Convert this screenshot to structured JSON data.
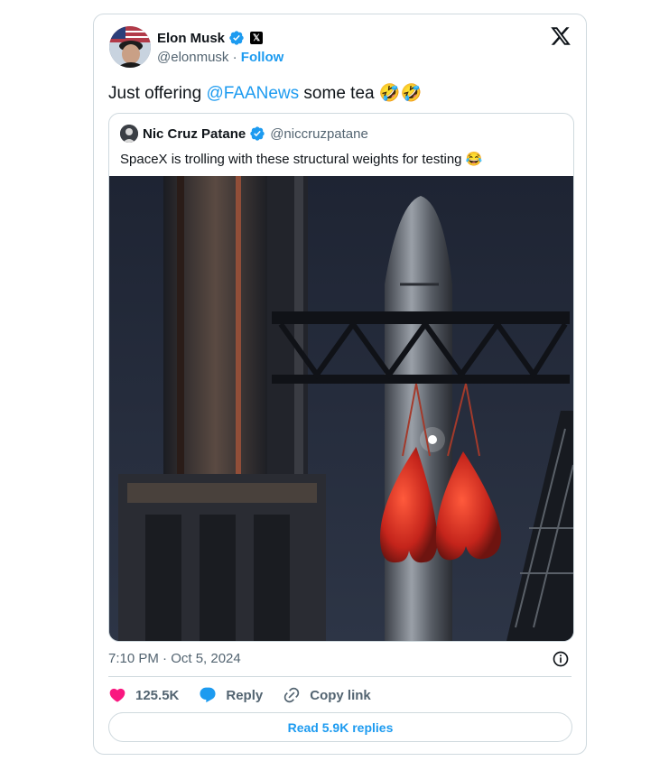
{
  "author": {
    "name": "Elon Musk",
    "handle": "@elonmusk",
    "separator": "·",
    "follow_label": "Follow"
  },
  "tweet": {
    "text_before": "Just offering ",
    "mention": "@FAANews",
    "text_after": " some tea 🤣🤣"
  },
  "quoted": {
    "name": "Nic Cruz Patane",
    "handle": "@niccruzpatane",
    "text": "SpaceX is trolling with these structural weights for testing 😂"
  },
  "meta": {
    "timestamp": "7:10 PM · Oct 5, 2024"
  },
  "actions": {
    "likes": "125.5K",
    "reply_label": "Reply",
    "copy_link_label": "Copy link"
  },
  "read_replies_label": "Read 5.9K replies",
  "colors": {
    "accent": "#1d9bf0",
    "like": "#f91880",
    "text": "#0f1419",
    "secondary": "#536471",
    "border": "#cfd9de"
  },
  "icons": [
    "verified-badge-icon",
    "x-badge-icon",
    "x-logo-icon",
    "info-icon",
    "heart-icon",
    "reply-icon",
    "link-icon"
  ]
}
